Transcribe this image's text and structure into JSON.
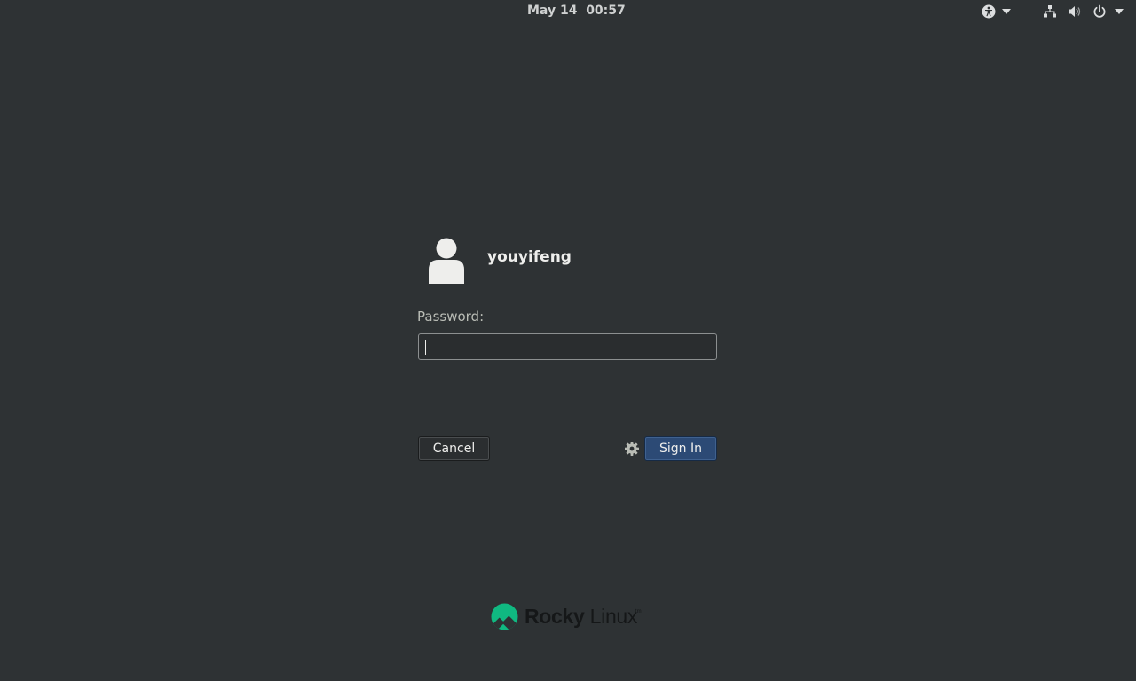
{
  "topbar": {
    "date": "May 14",
    "time": "00:57",
    "icons": {
      "accessibility": "accessibility-icon",
      "network": "network-icon",
      "volume": "volume-icon",
      "power": "power-icon"
    }
  },
  "login": {
    "username": "youyifeng",
    "password_label": "Password:",
    "password_value": "",
    "cancel_label": "Cancel",
    "signin_label": "Sign In"
  },
  "branding": {
    "name_bold": "Rocky",
    "name_light": "Linux",
    "tm": "tm",
    "accent_color": "#10b981"
  },
  "colors": {
    "background": "#2e3234",
    "signin_button": "#2c4a75"
  }
}
